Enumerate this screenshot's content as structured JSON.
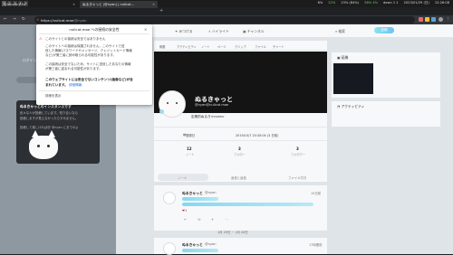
{
  "system_bar": {
    "workspaces": [
      "1",
      "2",
      "3",
      "4",
      "5"
    ],
    "active_workspace": 0,
    "stats": [
      {
        "text": "6%",
        "color": "#dddddd"
      },
      {
        "text": "22%",
        "color": "#6fcf6f"
      },
      {
        "text": "13% (84%)",
        "color": "#dddddd"
      },
      {
        "text": "58% 4%",
        "color": "#6fcf6f"
      },
      {
        "text": "down 1 1",
        "color": "#dddddd"
      },
      {
        "text": "2023/01/29 (日)",
        "color": "#dddddd"
      },
      {
        "text": "12:26:08",
        "color": "#dddddd"
      }
    ]
  },
  "browser": {
    "tabs": [
      {
        "title": "Discovery Ko",
        "active": false
      },
      {
        "title": "ぬるきゃっと (@nyan) | nullcat...",
        "active": true
      }
    ],
    "url_secure_label": "保護されていない通信",
    "url": "nullcat.mae/@nyan",
    "url_host": "https://nullcat.mae",
    "url_path": "/@nyan"
  },
  "popup": {
    "title": "nullcat.mae への接続の安全性",
    "lines_top": [
      "このサイトとの接続は安全ではありません"
    ],
    "para1": [
      "このサイトへの接続は保護されません。このサイトで送",
      "信した情報(パスワードやメッセージ、クレジットカード情報",
      "など)が第三者に読み取られる可能性があります。"
    ],
    "para2": [
      "この接続は安全でないため、サイトに送信したあなたの情報",
      "が第三者に盗まれる可能性があります。"
    ],
    "warning1": "このウェブサイトには安全でないコンテンツ(画像など)が含",
    "warning2": "まれています。",
    "warning_link": "詳細情報",
    "details": "詳細を表示"
  },
  "left_pane": {
    "hint": "ログインすると参加できます",
    "info_title": "ぬるきゃっとのインスタンスです",
    "info_lines": [
      "色々な人が投稿しています。知り合いなら",
      "投稿しますが見えなかったらすみません。",
      "",
      ""
    ],
    "info_line_mention": "投稿して楽しければ@ @nyan にまでのよ"
  },
  "top_nav": {
    "items": [
      "みつける",
      "ハイライト",
      "チャンネル"
    ],
    "right_label": "検索",
    "post_button": "投稿"
  },
  "profile": {
    "tabs": [
      "概要",
      "アクティビティ",
      "ノート",
      "ページ",
      "クリップ",
      "ファイル",
      "チャート"
    ],
    "name": "ぬるきゃっと",
    "handle": "@nyan@nullcat.mae",
    "description": "定期的ぬるきゃnoenu",
    "joined_label": "登録日",
    "joined_value": "2019/10/7 20:30:04 (3 日前)",
    "stats": [
      {
        "value": "12",
        "label": "ノート"
      },
      {
        "value": "3",
        "label": "フォロー"
      },
      {
        "value": "3",
        "label": "フォロワー"
      }
    ]
  },
  "timeline_tabs": [
    "ノート",
    "返信と返信",
    "ファイル付き"
  ],
  "notes": [
    {
      "name": "ぬるきゃっと",
      "handle": "@nyan",
      "time": "10日前",
      "reaction": "1",
      "date_sep": "1月 29日 ~ 1月 20日"
    },
    {
      "name": "ぬるきゃっと",
      "handle": "@nyan",
      "time": "17時間前",
      "reaction": "",
      "date_sep": ""
    }
  ],
  "widgets": {
    "image_title": "画像",
    "activity_title": "アクティビティ"
  }
}
